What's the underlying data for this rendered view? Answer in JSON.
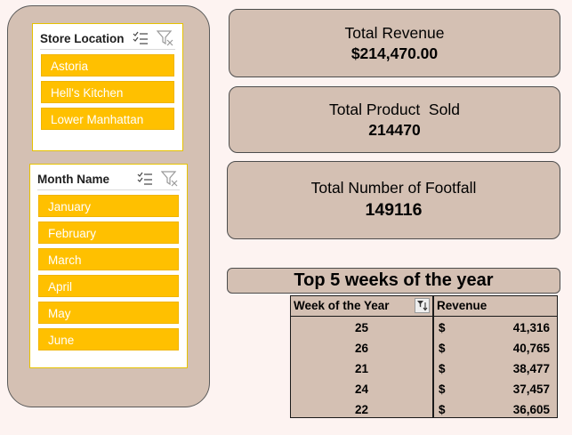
{
  "store_slicer": {
    "title": "Store Location",
    "items": [
      "Astoria",
      "Hell's Kitchen",
      "Lower Manhattan"
    ]
  },
  "month_slicer": {
    "title": "Month Name",
    "items": [
      "January",
      "February",
      "March",
      "April",
      "May",
      "June"
    ]
  },
  "kpis": {
    "revenue": {
      "label": "Total Revenue",
      "value": "$214,470.00"
    },
    "products": {
      "label": "Total Product  Sold",
      "value": "214470"
    },
    "footfall": {
      "label": "Total Number of Footfall",
      "value": "149116"
    }
  },
  "top_weeks": {
    "title": "Top 5 weeks of the year",
    "headers": {
      "week": "Week of the Year",
      "revenue": "Revenue"
    },
    "currency": "$",
    "rows": [
      {
        "week": "25",
        "revenue": "41,316"
      },
      {
        "week": "26",
        "revenue": "40,765"
      },
      {
        "week": "21",
        "revenue": "38,477"
      },
      {
        "week": "24",
        "revenue": "37,457"
      },
      {
        "week": "22",
        "revenue": "36,605"
      }
    ]
  },
  "icons": {
    "multiselect": "multi-select-icon",
    "clear_filter": "clear-filter-icon",
    "sort_filter": "sort-filter-icon"
  },
  "colors": {
    "panel": "#d4c0b3",
    "slicer_item": "#ffc000",
    "background": "#fdf3f1"
  }
}
